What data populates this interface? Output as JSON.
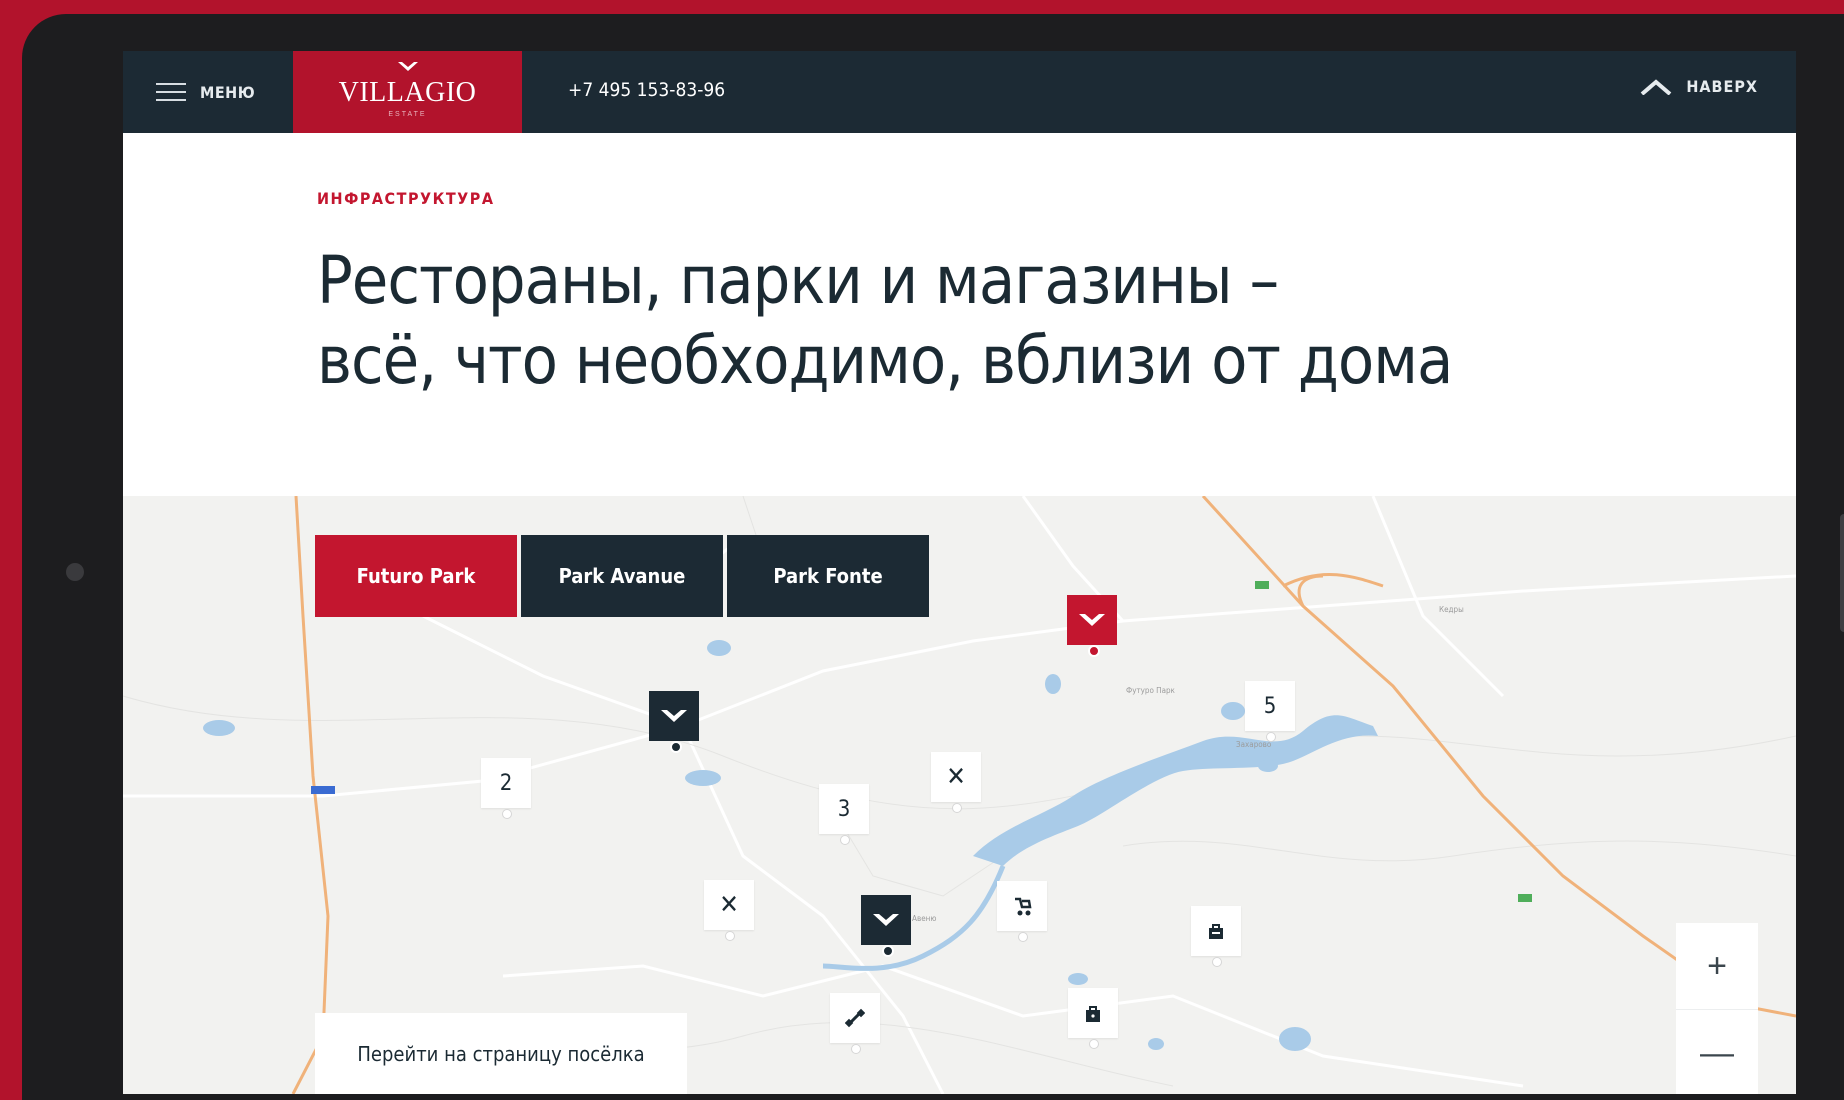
{
  "header": {
    "menu_label": "МЕНЮ",
    "logo_text": "VILLAGIO",
    "logo_subtext": "ESTATE",
    "phone": "+7 495 153-83-96",
    "top_label": "НАВЕРХ"
  },
  "content": {
    "section_label": "ИНФРАСТРУКТУРА",
    "headline_line1": "Рестораны, парки и магазины –",
    "headline_line2": "всё, что необходимо, вблизи от дома"
  },
  "map": {
    "tabs": [
      {
        "label": "Futuro Park",
        "active": true
      },
      {
        "label": "Park Avanue",
        "active": false
      },
      {
        "label": "Park Fonte",
        "active": false
      }
    ],
    "goto_label": "Перейти на страницу посёлка",
    "zoom": {
      "in": "+",
      "out": "—"
    },
    "markers": {
      "cluster_2": "2",
      "cluster_3": "3",
      "cluster_5": "5"
    },
    "places": {
      "futuro": "Футуро Парк",
      "park_avenue": "Парк Авеню",
      "kedry": "Кедры",
      "zakharovo": "Захарово"
    }
  },
  "colors": {
    "brand_red": "#c3162f",
    "dark": "#1c2a34",
    "road": "#f0b27a",
    "water": "#a9cbe8",
    "frame": "#b2132c"
  }
}
